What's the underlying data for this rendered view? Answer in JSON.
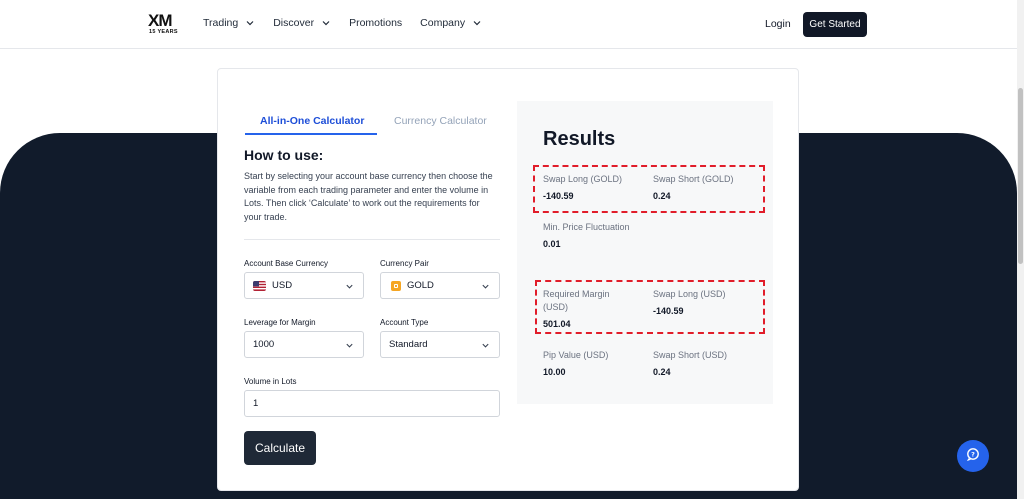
{
  "header": {
    "logo_text": "XM",
    "logo_years": "15 YEARS",
    "nav": [
      {
        "label": "Trading",
        "has_dropdown": true
      },
      {
        "label": "Discover",
        "has_dropdown": true
      },
      {
        "label": "Promotions",
        "has_dropdown": false
      },
      {
        "label": "Company",
        "has_dropdown": true
      }
    ],
    "login": "Login",
    "get_started": "Get Started"
  },
  "calculator": {
    "tabs": [
      {
        "label": "All-in-One Calculator",
        "active": true
      },
      {
        "label": "Currency Calculator",
        "active": false
      }
    ],
    "how_to_title": "How to use:",
    "how_to_text": "Start by selecting your account base currency then choose the variable from each trading parameter and enter the volume in Lots. Then click ‘Calculate’ to work out the requirements for your trade.",
    "fields": {
      "base_currency": {
        "label": "Account Base Currency",
        "value": "USD",
        "icon": "us-flag-icon"
      },
      "currency_pair": {
        "label": "Currency Pair",
        "value": "GOLD",
        "icon": "gold-icon"
      },
      "leverage": {
        "label": "Leverage for Margin",
        "value": "1000"
      },
      "account_type": {
        "label": "Account Type",
        "value": "Standard"
      },
      "volume": {
        "label": "Volume in Lots",
        "value": "1"
      }
    },
    "calculate_label": "Calculate"
  },
  "results": {
    "title": "Results",
    "swap_long_gold": {
      "label": "Swap Long (GOLD)",
      "value": "-140.59"
    },
    "swap_short_gold": {
      "label": "Swap Short (GOLD)",
      "value": "0.24"
    },
    "min_price_fluctuation": {
      "label": "Min. Price Fluctuation",
      "value": "0.01"
    },
    "required_margin": {
      "label": "Required Margin (USD)",
      "value": "501.04"
    },
    "swap_long_usd": {
      "label": "Swap Long (USD)",
      "value": "-140.59"
    },
    "pip_value": {
      "label": "Pip Value (USD)",
      "value": "10.00"
    },
    "swap_short_usd": {
      "label": "Swap Short (USD)",
      "value": "0.24"
    }
  },
  "colors": {
    "accent_blue": "#2563eb",
    "dark_bg": "#111b2b",
    "highlight_red": "#e11d2a",
    "button_dark": "#1f2937"
  }
}
